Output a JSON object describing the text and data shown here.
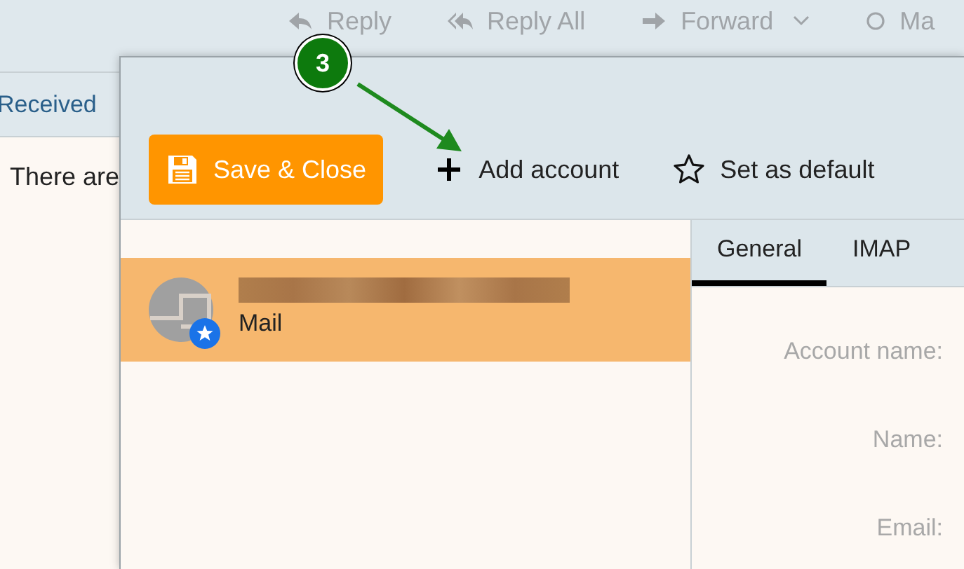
{
  "background_app": {
    "toolbar": [
      {
        "label": "Reply",
        "kind": "reply",
        "disabled": true
      },
      {
        "label": "Reply All",
        "kind": "reply_all",
        "disabled": true
      },
      {
        "label": "Forward",
        "kind": "forward",
        "disabled": true
      },
      {
        "label": "Ma",
        "kind": "mark",
        "disabled": true
      }
    ],
    "folder_heading": "Received",
    "message": "There are"
  },
  "dialog": {
    "toolbar": {
      "save_button": "Save & Close",
      "add_account": "Add account",
      "set_default": "Set as default"
    },
    "accounts": [
      {
        "type": "Mail",
        "selected": true,
        "default": true
      }
    ],
    "tabs": [
      {
        "label": "General",
        "selected": true
      },
      {
        "label": "IMAP",
        "selected": false
      }
    ],
    "fields": [
      {
        "label": "Account name:"
      },
      {
        "label": "Name:"
      },
      {
        "label": "Email:"
      }
    ]
  },
  "annotation": {
    "number": "3"
  }
}
